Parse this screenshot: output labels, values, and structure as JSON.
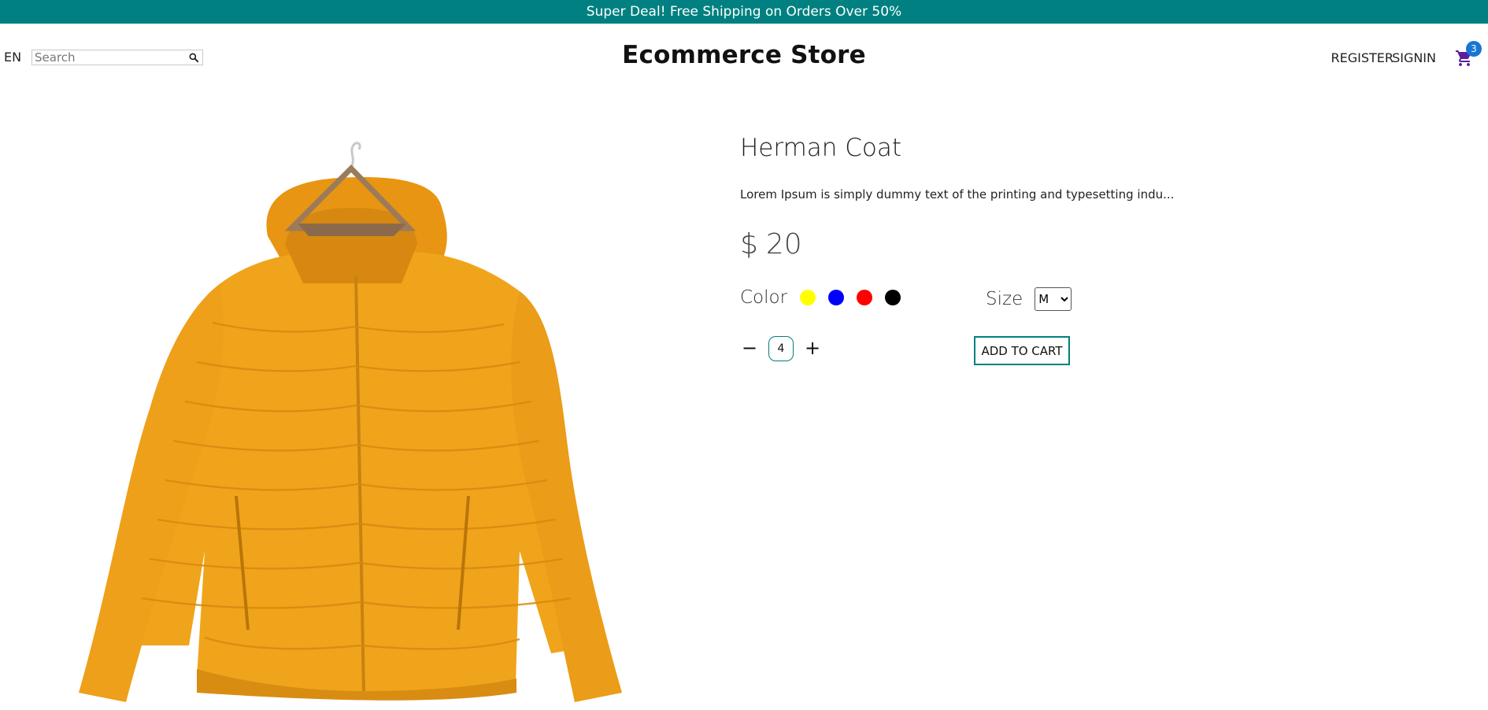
{
  "announcement": {
    "text": "Super Deal! Free Shipping on Orders Over 50%"
  },
  "navbar": {
    "language": "EN",
    "search": {
      "placeholder": "Search",
      "value": ""
    },
    "brand": "Ecommerce Store",
    "links": {
      "register": "REGISTER",
      "signin": "SIGNIN"
    },
    "cart": {
      "count": "3"
    }
  },
  "product": {
    "image_alt": "yellow puffer jacket on hanger",
    "title": "Herman Coat",
    "description": "Lorem Ipsum is simply dummy text of the printing and typesetting indu...",
    "price": {
      "currency": "$",
      "amount": "20"
    },
    "color": {
      "label": "Color",
      "options": [
        "#ffff00",
        "#0000ff",
        "#ff0000",
        "#000000"
      ]
    },
    "size": {
      "label": "Size",
      "selected": "M",
      "options": [
        "M"
      ]
    },
    "quantity": {
      "minus": "−",
      "value": "4",
      "plus": "+"
    },
    "add_to_cart": "ADD TO CART"
  },
  "colors": {
    "accent": "#008080",
    "badge": "#1976d2",
    "cart_icon": "#5b1f9e",
    "jacket": "#f0a41c"
  }
}
